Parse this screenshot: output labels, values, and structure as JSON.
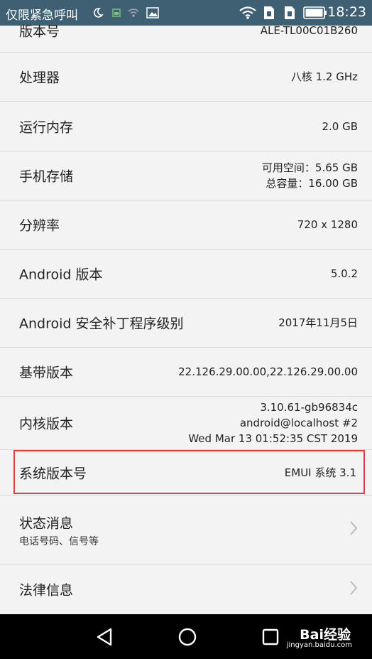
{
  "status_bar": {
    "carrier": "仅限紧急呼叫",
    "time": "18:23",
    "icons": [
      "moon-icon",
      "signal-small-icon",
      "wifi-small-icon",
      "gallery-icon",
      "wifi-icon",
      "sim-icon",
      "sim2-icon",
      "battery-icon"
    ]
  },
  "rows": {
    "version_number": {
      "label": "版本号",
      "value": "ALE-TL00C01B260"
    },
    "processor": {
      "label": "处理器",
      "value": "八核 1.2 GHz"
    },
    "ram": {
      "label": "运行内存",
      "value": "2.0 GB"
    },
    "storage": {
      "label": "手机存储",
      "value_line1": "可用空间：5.65  GB",
      "value_line2": "总容量：16.00  GB"
    },
    "resolution": {
      "label": "分辨率",
      "value": "720 x 1280"
    },
    "android_version": {
      "label": "Android 版本",
      "value": "5.0.2"
    },
    "security_patch": {
      "label": "Android 安全补丁程序级别",
      "value": "2017年11月5日"
    },
    "baseband": {
      "label": "基带版本",
      "value": "22.126.29.00.00,22.126.29.00.00"
    },
    "kernel": {
      "label": "内核版本",
      "value_line1": "3.10.61-gb96834c",
      "value_line2": "android@localhost #2",
      "value_line3": "Wed Mar 13 01:52:35 CST 2019"
    },
    "system_version": {
      "label": "系统版本号",
      "value": "EMUI 系统 3.1"
    },
    "status": {
      "label": "状态消息",
      "sub": "电话号码、信号等"
    },
    "legal": {
      "label": "法律信息"
    }
  },
  "watermark": {
    "brand": "Bai经验",
    "url": "jingyan.baidu.com"
  }
}
